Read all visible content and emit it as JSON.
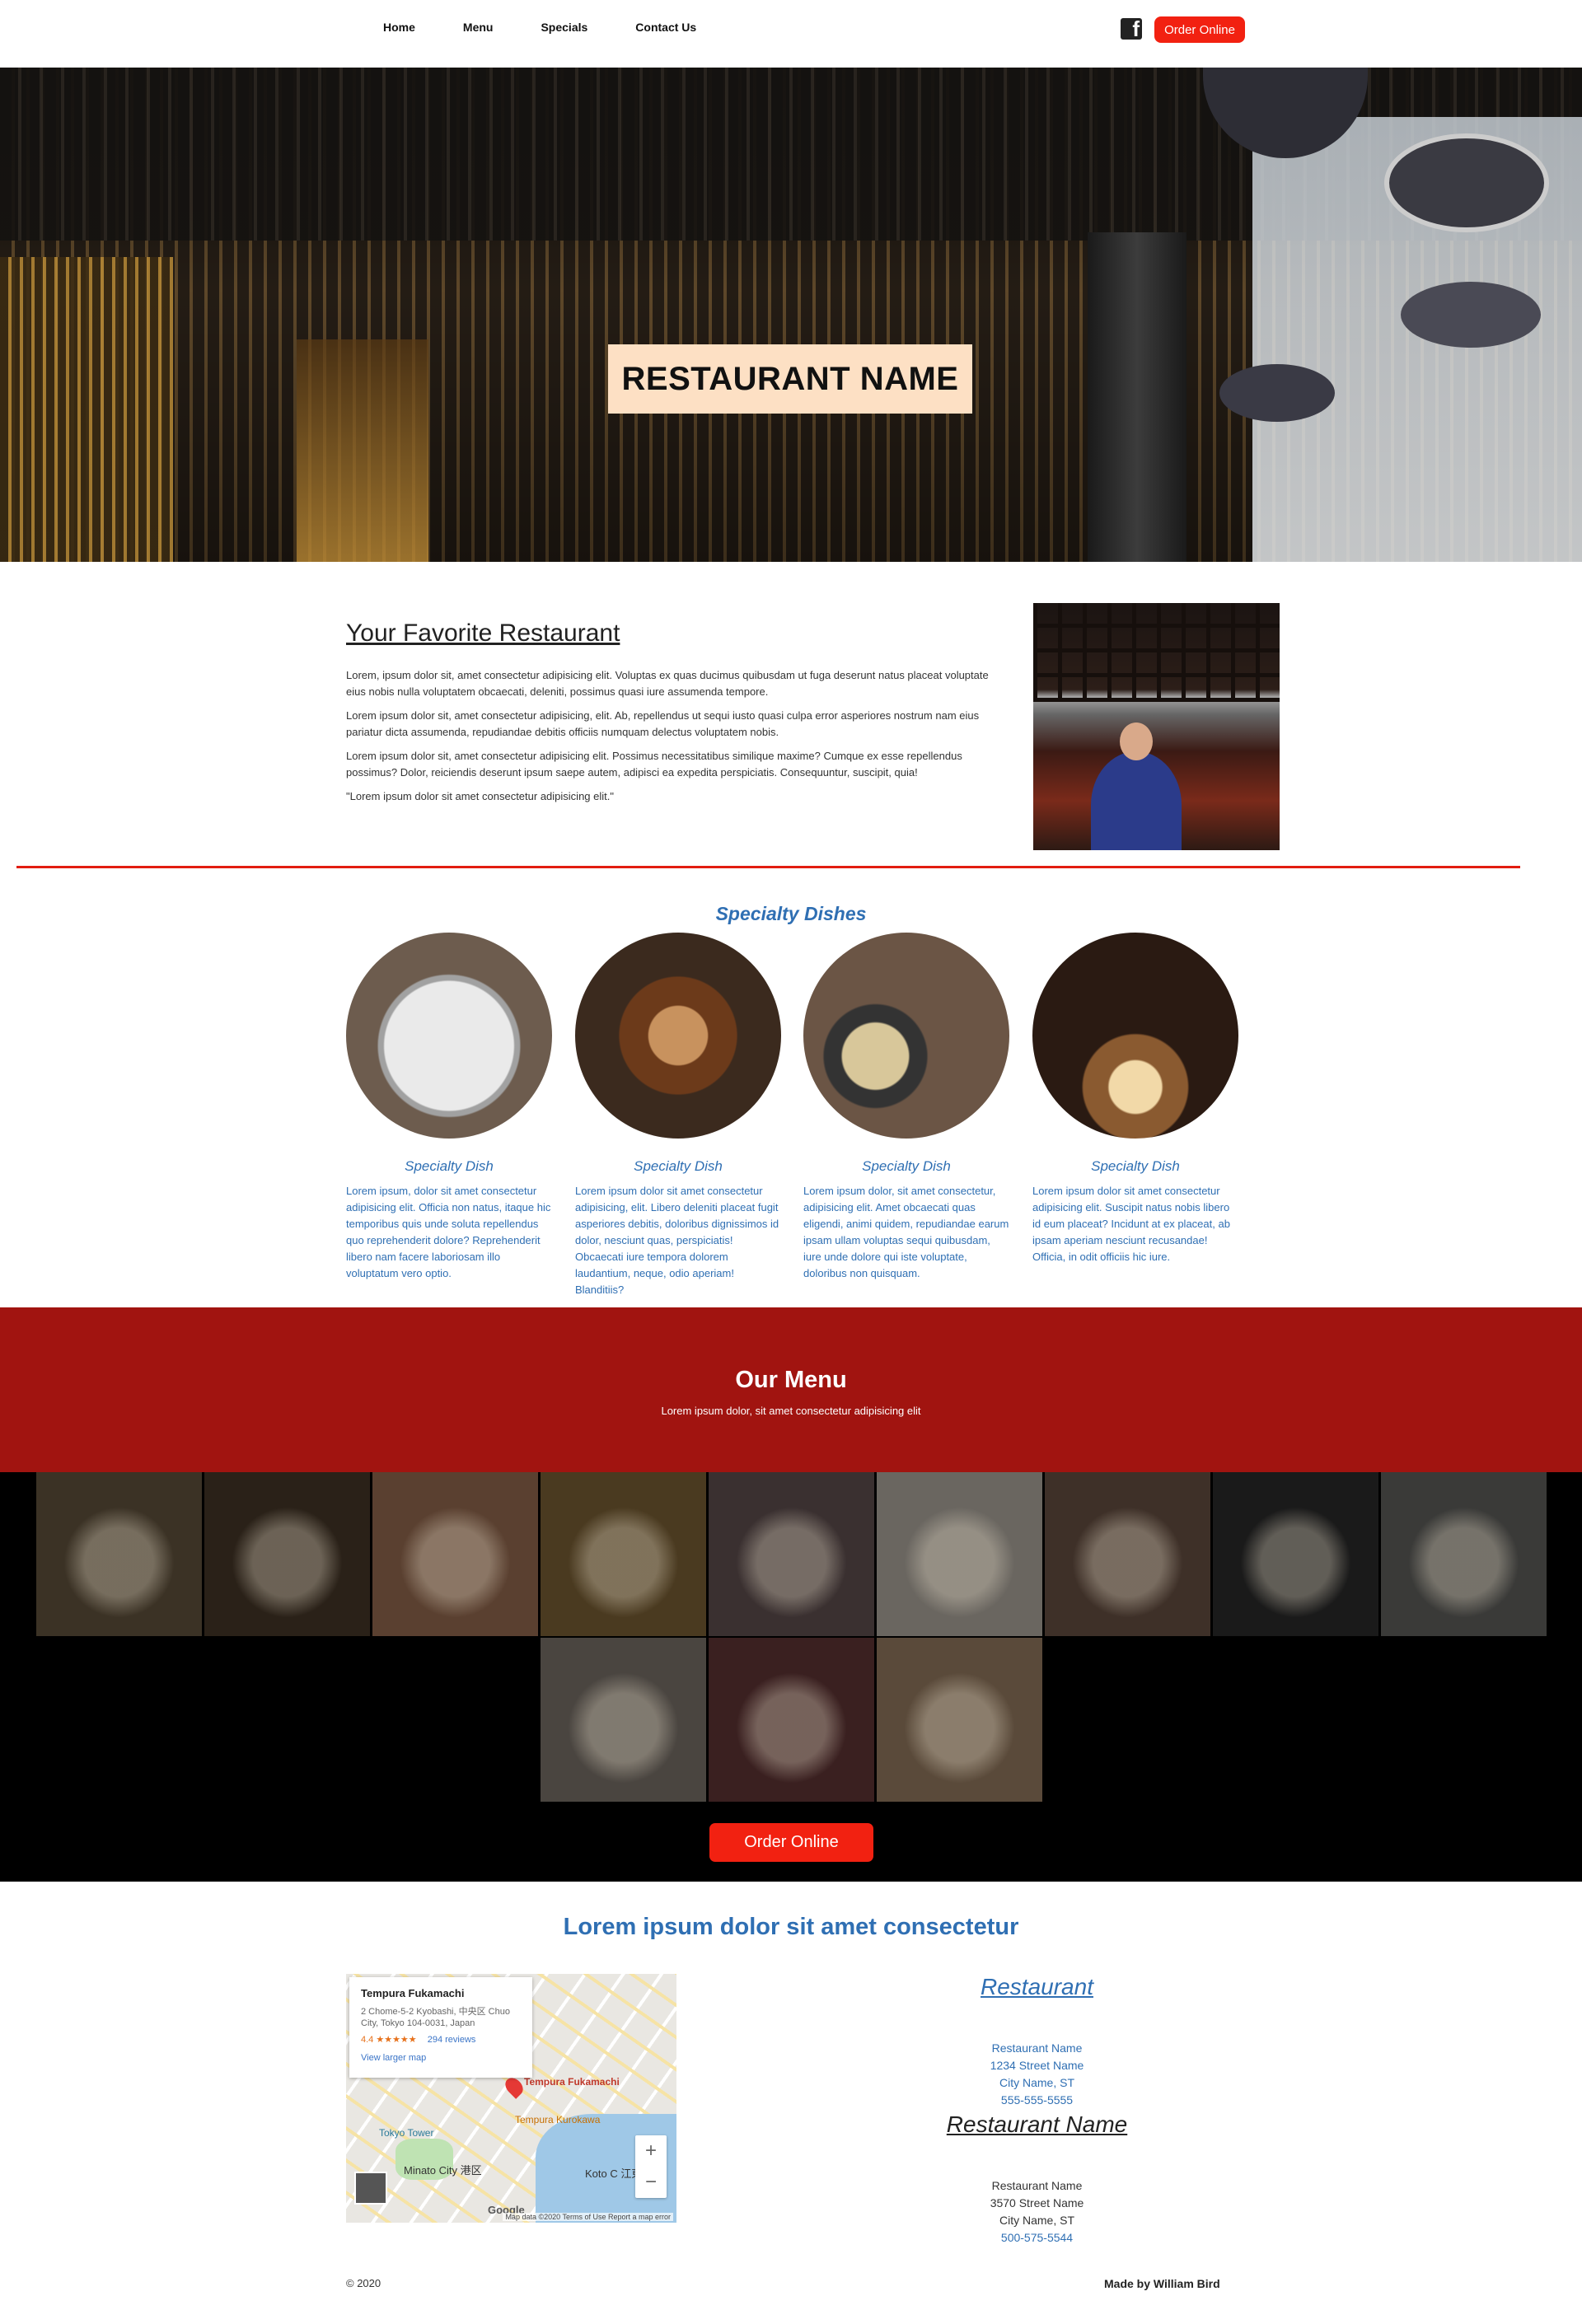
{
  "nav": {
    "links": [
      "Home",
      "Menu",
      "Specials",
      "Contact Us"
    ],
    "order_button": "Order Online",
    "social_icon": "facebook-icon"
  },
  "hero": {
    "title": "RESTAURANT NAME"
  },
  "about": {
    "heading": "Your Favorite Restaurant",
    "paragraphs": [
      "Lorem, ipsum dolor sit, amet consectetur adipisicing elit. Voluptas ex quas ducimus quibusdam ut fuga deserunt natus placeat voluptate eius nobis nulla voluptatem obcaecati, deleniti, possimus quasi iure assumenda tempore.",
      "Lorem ipsum dolor sit, amet consectetur adipisicing, elit. Ab, repellendus ut sequi iusto quasi culpa error asperiores nostrum nam eius pariatur dicta assumenda, repudiandae debitis officiis numquam delectus voluptatem nobis.",
      "Lorem ipsum dolor sit, amet consectetur adipisicing elit. Possimus necessitatibus similique maxime? Cumque ex esse repellendus possimus? Dolor, reiciendis deserunt ipsum saepe autem, adipisci ea expedita perspiciatis. Consequuntur, suscipit, quia!",
      "\"Lorem ipsum dolor sit amet consectetur adipisicing elit.\""
    ]
  },
  "specialty": {
    "heading": "Specialty Dishes",
    "dishes": [
      {
        "name": "Specialty Dish",
        "desc": "Lorem ipsum, dolor sit amet consectetur adipisicing elit. Officia non natus, itaque hic temporibus quis unde soluta repellendus quo reprehenderit dolore? Reprehenderit libero nam facere laboriosam illo voluptatum vero optio."
      },
      {
        "name": "Specialty Dish",
        "desc": "Lorem ipsum dolor sit amet consectetur adipisicing, elit. Libero deleniti placeat fugit asperiores debitis, doloribus dignissimos id dolor, nesciunt quas, perspiciatis! Obcaecati iure tempora dolorem laudantium, neque, odio aperiam! Blanditiis?"
      },
      {
        "name": "Specialty Dish",
        "desc": "Lorem ipsum dolor, sit amet consectetur, adipisicing elit. Amet obcaecati quas eligendi, animi quidem, repudiandae earum ipsam ullam voluptas sequi quibusdam, iure unde dolore qui iste voluptate, doloribus non quisquam."
      },
      {
        "name": "Specialty Dish",
        "desc": "Lorem ipsum dolor sit amet consectetur adipisicing elit. Suscipit natus nobis libero id eum placeat? Incidunt at ex placeat, ab ipsam aperiam nesciunt recusandae! Officia, in odit officiis hic iure."
      }
    ]
  },
  "menu": {
    "title": "Our Menu",
    "subtitle": "Lorem ipsum dolor, sit amet consectetur adipisicing elit",
    "order_button": "Order Online",
    "gallery_colors": [
      "#3b3225",
      "#2a2118",
      "#5a4030",
      "#4a3a20",
      "#3a3030",
      "#6a6660",
      "#3e3028",
      "#1a1a1a",
      "#3a3a38",
      "#4a4540",
      "#3a2020",
      "#5a4a3a"
    ]
  },
  "location": {
    "heading": "Lorem ipsum dolor sit amet consectetur",
    "map": {
      "place": "Tempura Fukamachi",
      "address": "2 Chome-5-2 Kyobashi, 中央区 Chuo City, Tokyo 104-0031, Japan",
      "rating": "4.4 ★★★★★",
      "reviews": "294 reviews",
      "view_larger": "View larger map",
      "pin_label": "Tempura Fukamachi",
      "label_tower": "Tokyo Tower",
      "label_kurokawa": "Tempura Kurokawa",
      "label_minato": "Minato City 港区",
      "label_koto": "Koto C 江東区",
      "google": "Google",
      "attribution": "Map data ©2020   Terms of Use   Report a map error",
      "zoom_in": "+",
      "zoom_out": "−"
    },
    "restaurant1": {
      "title": "Restaurant",
      "lines": [
        "Restaurant Name",
        "1234 Street Name",
        "City Name, ST",
        "555-555-5555"
      ]
    },
    "restaurant2": {
      "title": "Restaurant Name",
      "lines": [
        "Restaurant Name",
        "3570 Street Name",
        "City Name, ST",
        "500-575-5544"
      ]
    },
    "link_color": "#2f6fb3"
  },
  "footer": {
    "copyright": "© 2020",
    "credit": "Made by William Bird"
  }
}
